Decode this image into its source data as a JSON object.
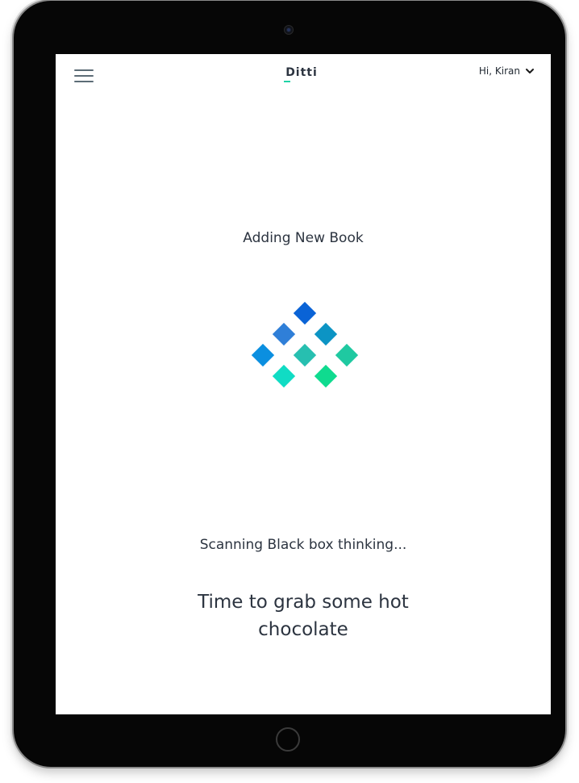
{
  "header": {
    "menu_icon": "hamburger-menu-icon",
    "logo_text": "Ditti",
    "user_greeting": "Hi, Kiran",
    "user_menu_icon": "chevron-down-icon"
  },
  "main": {
    "heading": "Adding New Book",
    "loader_icon": "diamond-grid-loader-icon",
    "status_text": "Scanning Black box thinking...",
    "message": "Time to grab some hot chocolate"
  },
  "colors": {
    "accent": "#1fd3a6",
    "text": "#2c3440",
    "loader_blue": "#0a66d8",
    "loader_green": "#11d98c"
  }
}
